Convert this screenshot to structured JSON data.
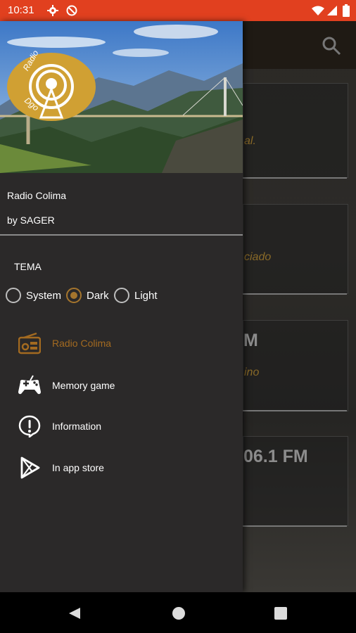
{
  "status_bar": {
    "time": "10:31",
    "left_icons": [
      "gear-icon",
      "no-sync-icon"
    ],
    "right_icons": [
      "wifi-icon",
      "signal-icon",
      "battery-icon"
    ],
    "color": "#e1401f"
  },
  "drawer": {
    "logo_text_top": "Radio",
    "logo_text_bottom": "Dgo",
    "app_name": "Radio Colima",
    "author": "by SAGER",
    "theme_title": "TEMA",
    "theme_options": [
      {
        "label": "System",
        "selected": false
      },
      {
        "label": "Dark",
        "selected": true
      },
      {
        "label": "Light",
        "selected": false
      }
    ],
    "menu": [
      {
        "label": "Radio Colima",
        "icon": "radio-icon",
        "active": true
      },
      {
        "label": "Memory game",
        "icon": "gamepad-icon",
        "active": false
      },
      {
        "label": "Information",
        "icon": "info-icon",
        "active": false
      },
      {
        "label": "In app store",
        "icon": "play-store-icon",
        "active": false
      }
    ],
    "accent": "#a5752d"
  },
  "background": {
    "text_1": "al.",
    "text_2": "ciado",
    "text_3": "M",
    "text_4": "ino",
    "text_5": "06.1 FM"
  }
}
